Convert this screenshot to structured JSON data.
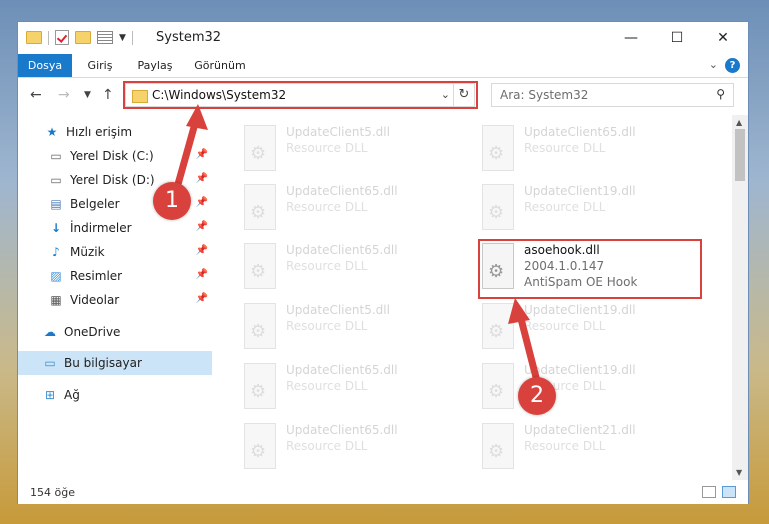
{
  "window": {
    "title": "System32",
    "controls": {
      "minimize": "—",
      "maximize": "☐",
      "close": "✕"
    }
  },
  "ribbon": {
    "tabs": [
      {
        "label": "Dosya",
        "active": true
      },
      {
        "label": "Giriş"
      },
      {
        "label": "Paylaş"
      },
      {
        "label": "Görünüm"
      }
    ],
    "help": "?"
  },
  "nav": {
    "address": "C:\\Windows\\System32",
    "search_placeholder": "Ara: System32"
  },
  "sidebar": {
    "items": [
      {
        "label": "Hızlı erişim",
        "icon": "star-icon",
        "pinned": false
      },
      {
        "label": "Yerel Disk (C:)",
        "icon": "drive-icon",
        "pinned": true
      },
      {
        "label": "Yerel Disk (D:)",
        "icon": "drive-icon",
        "pinned": true
      },
      {
        "label": "Belgeler",
        "icon": "documents-icon",
        "pinned": true
      },
      {
        "label": "İndirmeler",
        "icon": "download-icon",
        "pinned": true
      },
      {
        "label": "Müzik",
        "icon": "music-icon",
        "pinned": true
      },
      {
        "label": "Resimler",
        "icon": "pictures-icon",
        "pinned": true
      },
      {
        "label": "Videolar",
        "icon": "video-icon",
        "pinned": true
      },
      {
        "label": "OneDrive",
        "icon": "cloud-icon",
        "pinned": false
      },
      {
        "label": "Bu bilgisayar",
        "icon": "computer-icon",
        "pinned": false,
        "selected": true
      },
      {
        "label": "Ağ",
        "icon": "network-icon",
        "pinned": false
      }
    ]
  },
  "files": [
    {
      "name": "UpdateClient5.dll",
      "line1": "Resource DLL",
      "line2": ""
    },
    {
      "name": "UpdateClient65.dll",
      "line1": "Resource DLL",
      "line2": ""
    },
    {
      "name": "UpdateClient65.dll",
      "line1": "Resource DLL",
      "line2": ""
    },
    {
      "name": "UpdateClient19.dll",
      "line1": "Resource DLL",
      "line2": ""
    },
    {
      "name": "UpdateClient65.dll",
      "line1": "Resource DLL",
      "line2": ""
    },
    {
      "name": "asoehook.dll",
      "line1": "2004.1.0.147",
      "line2": "AntiSpam OE Hook",
      "highlighted": true
    },
    {
      "name": "UpdateClient5.dll",
      "line1": "Resource DLL",
      "line2": ""
    },
    {
      "name": "UpdateClient19.dll",
      "line1": "Resource DLL",
      "line2": ""
    },
    {
      "name": "UpdateClient65.dll",
      "line1": "Resource DLL",
      "line2": ""
    },
    {
      "name": "UpdateClient19.dll",
      "line1": "Resource DLL",
      "line2": ""
    },
    {
      "name": "UpdateClient65.dll",
      "line1": "Resource DLL",
      "line2": ""
    },
    {
      "name": "UpdateClient21.dll",
      "line1": "Resource DLL",
      "line2": ""
    }
  ],
  "status": {
    "count": "154 öğe"
  },
  "annotations": {
    "badge1": "1",
    "badge2": "2"
  },
  "colors": {
    "accent": "#1979ca",
    "highlight": "#d9423c",
    "selected_bg": "#cce4f7"
  }
}
